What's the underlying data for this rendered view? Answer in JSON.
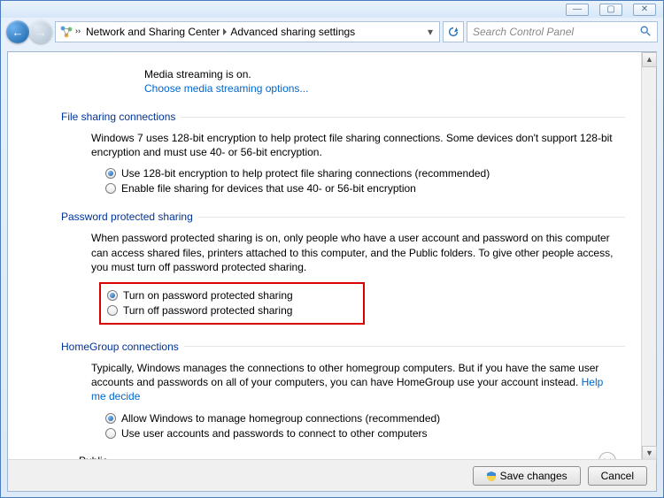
{
  "window": {
    "min_btn": "—",
    "max_btn": "▢",
    "close_btn": "✕"
  },
  "nav": {
    "back_glyph": "←",
    "fwd_glyph": "→",
    "bc_parent": "Network and Sharing Center",
    "bc_current": "Advanced sharing settings",
    "drop_glyph": "▾",
    "refresh_glyph": "↻",
    "search_placeholder": "Search Control Panel",
    "search_icon": "🔍"
  },
  "content": {
    "media_streaming_status": "Media streaming is on.",
    "media_streaming_link": "Choose media streaming options...",
    "sections": {
      "file_sharing": {
        "title": "File sharing connections",
        "body": "Windows 7 uses 128-bit encryption to help protect file sharing connections. Some devices don't support 128-bit encryption and must use 40- or 56-bit encryption.",
        "opt1": "Use 128-bit encryption to help protect file sharing connections (recommended)",
        "opt2": "Enable file sharing for devices that use 40- or 56-bit encryption"
      },
      "password": {
        "title": "Password protected sharing",
        "body": "When password protected sharing is on, only people who have a user account and password on this computer can access shared files, printers attached to this computer, and the Public folders. To give other people access, you must turn off password protected sharing.",
        "opt1": "Turn on password protected sharing",
        "opt2": "Turn off password protected sharing"
      },
      "homegroup": {
        "title": "HomeGroup connections",
        "body1": "Typically, Windows manages the connections to other homegroup computers. But if you have the same user accounts and passwords on all of your computers, you can have HomeGroup use your account instead. ",
        "help_link": "Help me decide",
        "opt1": "Allow Windows to manage homegroup connections (recommended)",
        "opt2": "Use user accounts and passwords to connect to other computers"
      }
    },
    "public_label": "Public"
  },
  "footer": {
    "save_label": "Save changes",
    "cancel_label": "Cancel"
  },
  "scrollbar": {
    "up": "▲",
    "down": "▼"
  }
}
